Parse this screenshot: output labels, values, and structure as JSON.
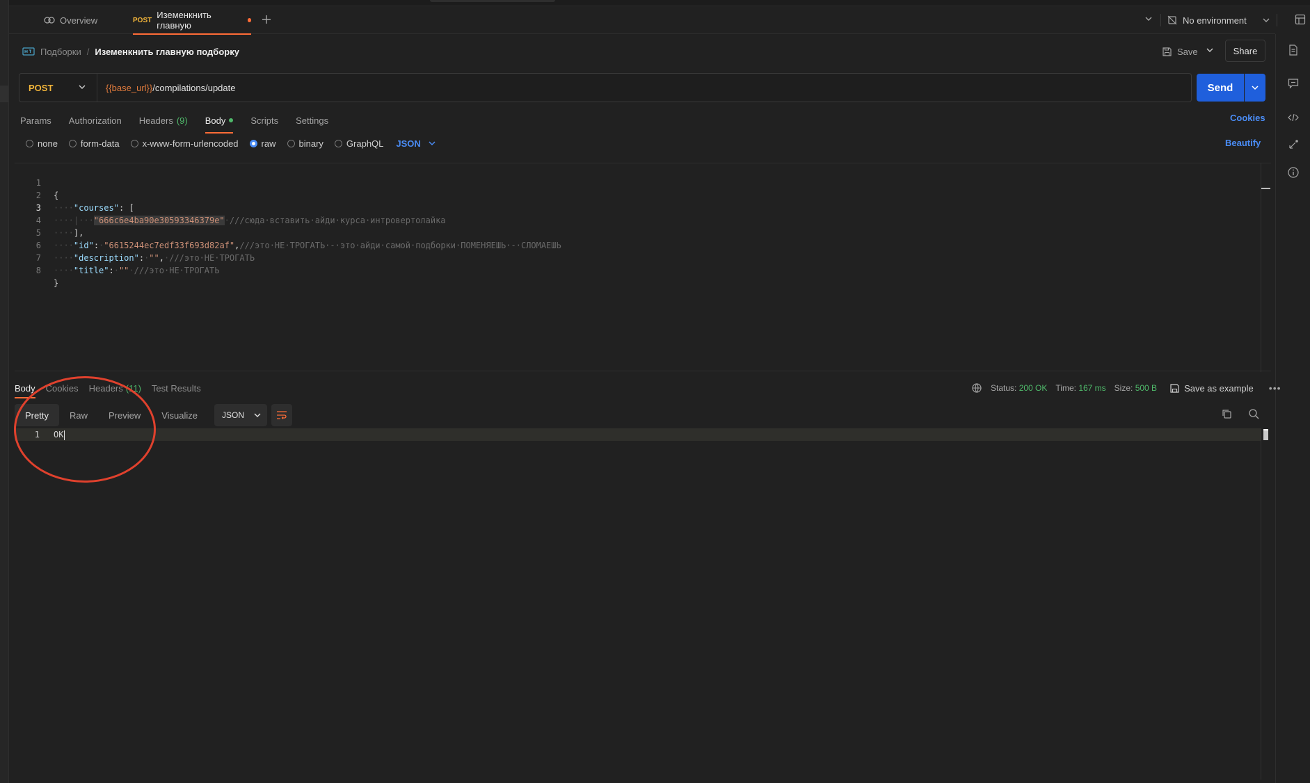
{
  "tabs": {
    "overview_label": "Overview",
    "active_method": "POST",
    "active_label": "Иземенкнить главную"
  },
  "environment": {
    "label": "No environment"
  },
  "breadcrumb": {
    "parent": "Подборки",
    "separator": "/",
    "current": "Иземенкнить главную подборку"
  },
  "actions": {
    "save_label": "Save",
    "share_label": "Share"
  },
  "request": {
    "method": "POST",
    "url_variable": "{{base_url}}",
    "url_path": "/compilations/update",
    "send_label": "Send"
  },
  "request_tabs": {
    "params": "Params",
    "authorization": "Authorization",
    "headers": "Headers",
    "headers_count": "(9)",
    "body": "Body",
    "scripts": "Scripts",
    "settings": "Settings",
    "cookies": "Cookies"
  },
  "body_options": {
    "none": "none",
    "form_data": "form-data",
    "urlencoded": "x-www-form-urlencoded",
    "raw": "raw",
    "binary": "binary",
    "graphql": "GraphQL",
    "format": "JSON",
    "selected": "raw",
    "beautify": "Beautify"
  },
  "editor": {
    "line_numbers": [
      "1",
      "2",
      "3",
      "4",
      "5",
      "6",
      "7",
      "8"
    ],
    "open_brace": "{",
    "courses_key": "\"courses\"",
    "courses_open": ": [",
    "course_id": "\"666c6e4ba90e30593346379e\"",
    "course_comment": "///сюда·вставить·айди·курса·интровертолайка",
    "courses_close": "],",
    "id_key": "\"id\"",
    "id_value": "\"6615244ec7edf33f693d82af\"",
    "id_comment": "///это·НЕ·ТРОГАТЬ·-·это·айди·самой·подборки·ПОМЕНЯЕШЬ·-·СЛОМАЕШЬ",
    "description_key": "\"description\"",
    "description_value": "\"\"",
    "description_comment": "///это·НЕ·ТРОГАТЬ",
    "title_key": "\"title\"",
    "title_value": "\"\"",
    "title_comment": "///это·НЕ·ТРОГАТЬ",
    "close_brace": "}"
  },
  "response": {
    "tabs": {
      "body": "Body",
      "cookies": "Cookies",
      "headers": "Headers",
      "headers_count": "(11)",
      "test_results": "Test Results"
    },
    "status_label": "Status:",
    "status_value": "200 OK",
    "time_label": "Time:",
    "time_value": "167 ms",
    "size_label": "Size:",
    "size_value": "500 B",
    "save_example": "Save as example",
    "more": "•••",
    "view_modes": {
      "pretty": "Pretty",
      "raw": "Raw",
      "preview": "Preview",
      "visualize": "Visualize"
    },
    "format": "JSON",
    "line_number": "1",
    "content": "OK"
  },
  "colors": {
    "accent_orange": "#ff6c37",
    "send_blue": "#1f5fdc",
    "link_blue": "#4a8cf5",
    "success_green": "#4fb86a",
    "method_yellow": "#f2b53a",
    "annotation_red": "#e0412d"
  },
  "icons": {
    "overview": "overview-icon",
    "plus": "plus-icon",
    "environment": "no-environment-icon",
    "env_settings": "environment-settings-icon",
    "collection": "http-request-icon",
    "save": "save-icon",
    "copy": "copy-icon",
    "search": "search-icon",
    "wrap": "wrap-lines-icon"
  }
}
